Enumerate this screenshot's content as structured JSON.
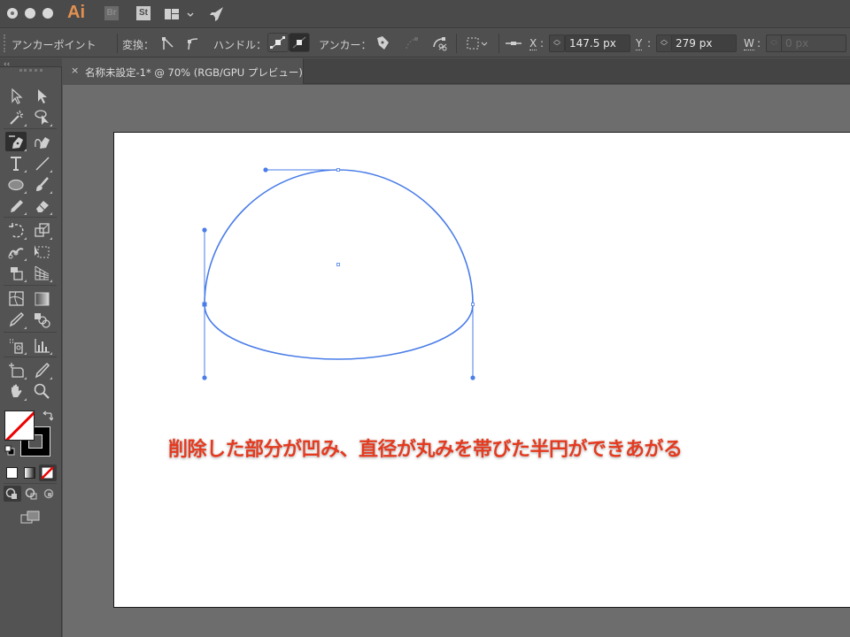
{
  "titlebar": {
    "app_logo": "Ai",
    "bridge_label": "Br",
    "stock_label": "St"
  },
  "controlbar": {
    "tool_name": "アンカーポイント",
    "convert_label": "変換：",
    "handles_label": "ハンドル：",
    "anchors_label": "アンカー：",
    "x_label": "X",
    "x_value": "147.5 px",
    "y_label": "Y",
    "y_value": "279 px",
    "w_label": "W",
    "w_value": "0 px",
    "colon": ":"
  },
  "document": {
    "tab_close": "×",
    "tab_title": "名称未設定-1* @ 70% (RGB/GPU プレビュー)"
  },
  "tools": {
    "collapse": "‹‹",
    "items": [
      "selection-tool",
      "direct-selection-tool",
      "magic-wand-tool",
      "lasso-tool",
      "pen-tool",
      "curvature-tool",
      "type-tool",
      "line-segment-tool",
      "ellipse-tool",
      "paintbrush-tool",
      "pencil-tool",
      "eraser-tool",
      "rotate-tool",
      "scale-tool",
      "puppet-warp-tool",
      "free-transform-tool",
      "shape-builder-tool",
      "perspective-grid-tool",
      "mesh-tool",
      "gradient-tool",
      "eyedropper-tool",
      "blend-tool",
      "symbol-sprayer-tool",
      "column-graph-tool",
      "artboard-tool",
      "slice-tool",
      "hand-tool",
      "zoom-tool"
    ],
    "active": "pen-tool"
  },
  "colors": {
    "fill": "none",
    "stroke": "#000000",
    "accent_path": "#4a7de8",
    "caption": "#e53a1f",
    "logo": "#e3904f"
  },
  "caption": {
    "text": "削除した部分が凹み、直径が丸みを帯びた半円ができあがる"
  }
}
